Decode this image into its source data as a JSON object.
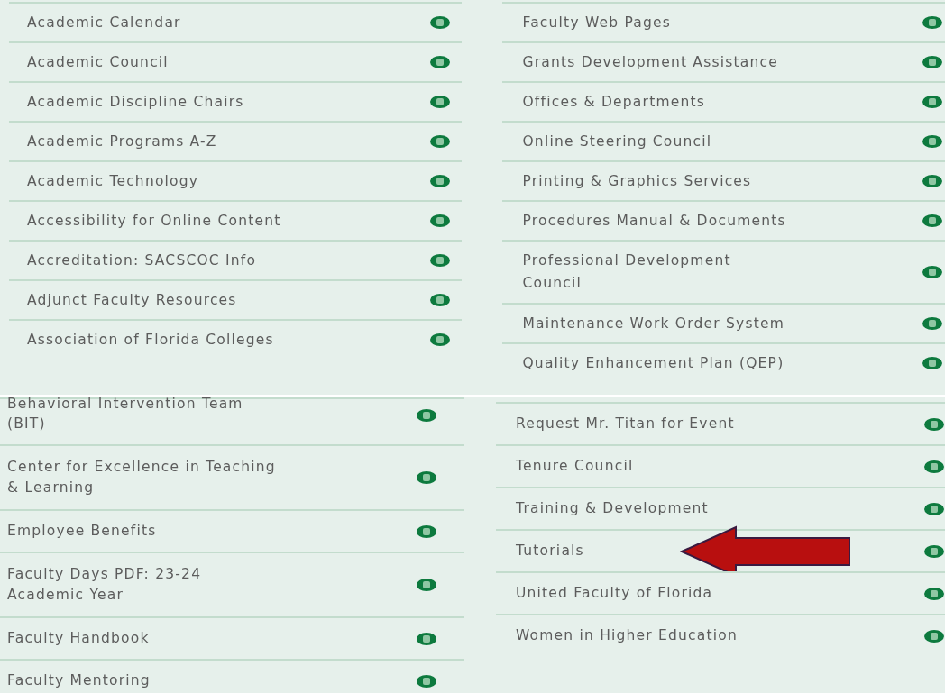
{
  "sections": [
    {
      "columns": [
        {
          "links": [
            {
              "label": "Academic Calendar",
              "annotated": false
            },
            {
              "label": "Academic Council",
              "annotated": false
            },
            {
              "label": "Academic Discipline Chairs",
              "annotated": false
            },
            {
              "label": "Academic Programs A-Z",
              "annotated": false
            },
            {
              "label": "Academic Technology",
              "annotated": false
            },
            {
              "label": "Accessibility for Online Content",
              "annotated": false
            },
            {
              "label": "Accreditation: SACSCOC Info",
              "annotated": false
            },
            {
              "label": "Adjunct Faculty Resources",
              "annotated": false
            },
            {
              "label": "Association of Florida Colleges",
              "annotated": false
            }
          ]
        },
        {
          "links": [
            {
              "label": "Faculty Web Pages",
              "annotated": false
            },
            {
              "label": "Grants Development Assistance",
              "annotated": false
            },
            {
              "label": "Offices & Departments",
              "annotated": false
            },
            {
              "label": "Online Steering Council",
              "annotated": false
            },
            {
              "label": "Printing & Graphics Services",
              "annotated": false
            },
            {
              "label": "Procedures Manual & Documents",
              "annotated": false
            },
            {
              "label": "Professional Development\nCouncil",
              "annotated": false
            },
            {
              "label": "Maintenance Work Order System",
              "annotated": false
            },
            {
              "label": "Quality Enhancement Plan (QEP)",
              "annotated": false
            }
          ]
        }
      ]
    },
    {
      "columns": [
        {
          "links": [
            {
              "label": "Behavioral Intervention Team\n(BIT)",
              "annotated": false
            },
            {
              "label": "Center for Excellence in Teaching\n& Learning",
              "annotated": false
            },
            {
              "label": "Employee Benefits",
              "annotated": false
            },
            {
              "label": "Faculty Days PDF: 23-24\nAcademic Year",
              "annotated": false
            },
            {
              "label": "Faculty Handbook",
              "annotated": false
            },
            {
              "label": "Faculty Mentoring",
              "annotated": false
            }
          ]
        },
        {
          "links": [
            {
              "label": "Request Mr. Titan for Event",
              "annotated": false
            },
            {
              "label": "Tenure Council",
              "annotated": false
            },
            {
              "label": "Training & Development",
              "annotated": false
            },
            {
              "label": "Tutorials",
              "annotated": true
            },
            {
              "label": "United Faculty of Florida",
              "annotated": false
            },
            {
              "label": "Women in Higher Education",
              "annotated": false
            }
          ]
        }
      ]
    }
  ]
}
